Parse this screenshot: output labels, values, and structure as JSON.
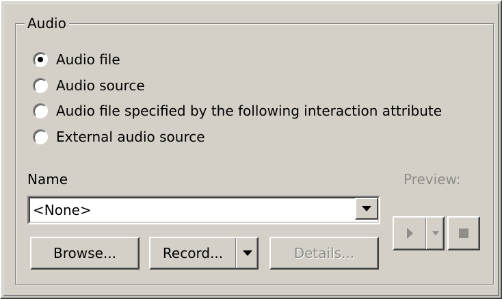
{
  "group": {
    "title": "Audio"
  },
  "radios": [
    {
      "label": "Audio file",
      "checked": true
    },
    {
      "label": "Audio source",
      "checked": false
    },
    {
      "label": "Audio file specified by the following interaction attribute",
      "checked": false
    },
    {
      "label": "External audio source",
      "checked": false
    }
  ],
  "name_field": {
    "label": "Name",
    "value": "<None>"
  },
  "preview": {
    "label": "Preview:",
    "play_icon": "play-icon",
    "dropdown_icon": "chevron-down-icon",
    "stop_icon": "stop-icon"
  },
  "buttons": {
    "browse": "Browse...",
    "record": "Record...",
    "details": "Details..."
  }
}
